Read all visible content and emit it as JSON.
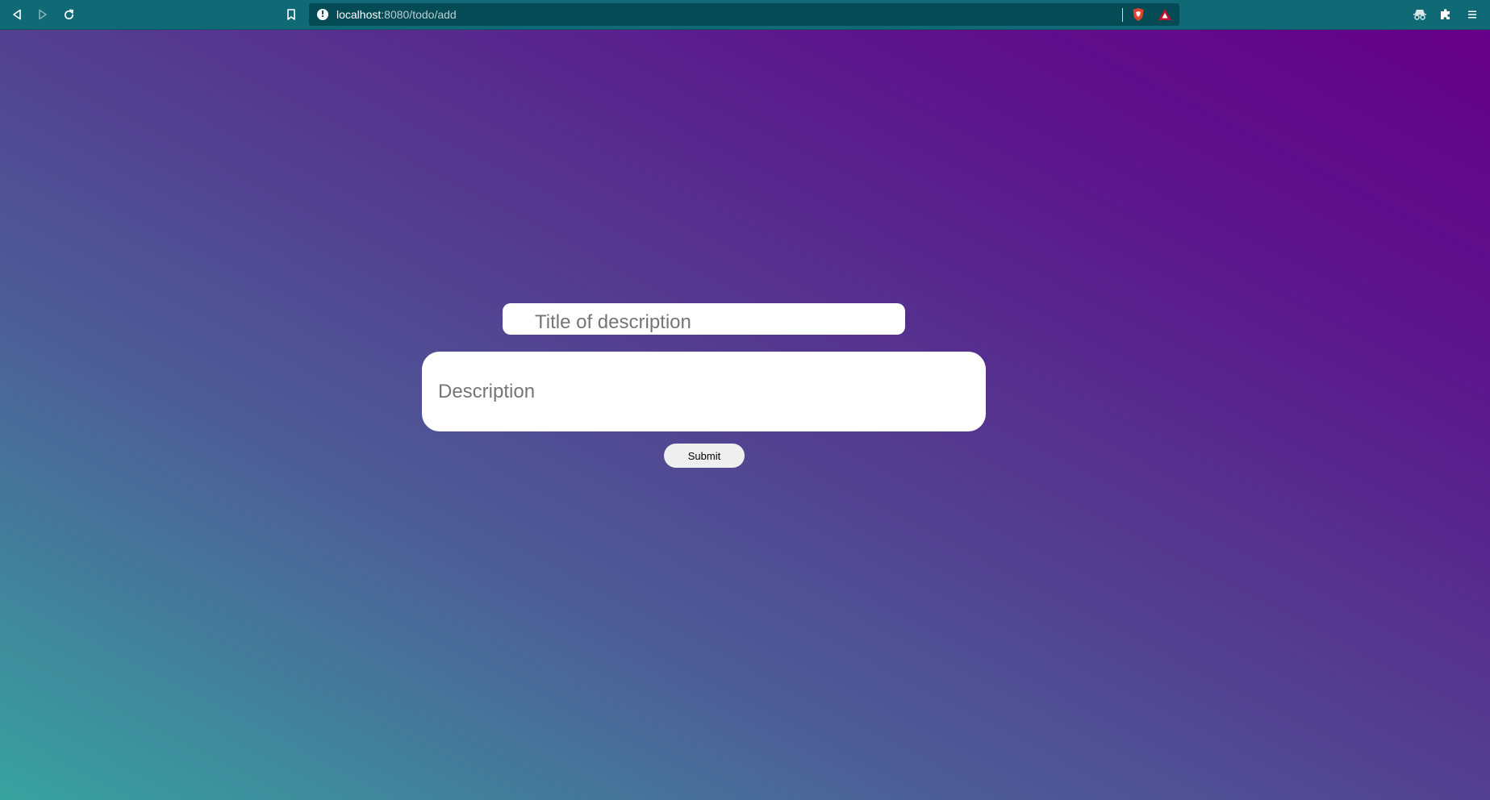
{
  "browser": {
    "url_host": "localhost",
    "url_rest": ":8080/todo/add",
    "site_info_symbol": "!",
    "icons": {
      "back": "back-arrow-icon",
      "forward": "forward-arrow-icon",
      "reload": "reload-icon",
      "bookmark": "bookmark-icon",
      "site_info": "info-icon",
      "brave_shield": "brave-shield-icon",
      "brave_rewards": "brave-rewards-icon",
      "incognito": "incognito-icon",
      "extensions": "puzzle-piece-icon",
      "menu": "hamburger-menu-icon"
    },
    "colors": {
      "toolbar": "#0f6a75",
      "address_bar": "#054b55",
      "brave_shield": "#e0432b",
      "brave_rewards": "#c0102c"
    }
  },
  "form": {
    "title_placeholder": "Title of description",
    "title_value": "",
    "description_placeholder": "Description",
    "description_value": "",
    "submit_label": "Submit"
  },
  "theme": {
    "gradient_start": "#37a39f",
    "gradient_mid": "#54398f",
    "gradient_end": "#660088"
  }
}
